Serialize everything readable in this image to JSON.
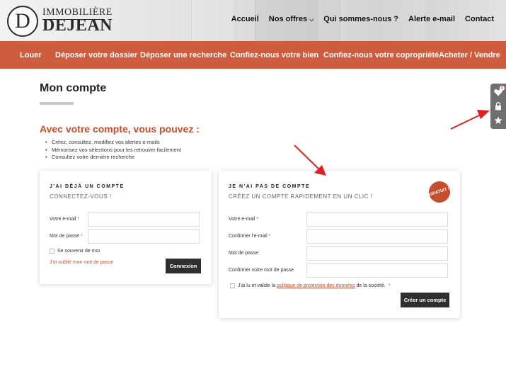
{
  "brand": {
    "logo_letter": "D",
    "line1": "IMMOBILIÈRE",
    "line2": "DEJEAN"
  },
  "top_nav": [
    {
      "label": "Accueil"
    },
    {
      "label": "Nos offres"
    },
    {
      "label": "Qui sommes-nous ?"
    },
    {
      "label": "Alerte e-mail"
    },
    {
      "label": "Contact"
    }
  ],
  "main_nav": [
    {
      "label": "Louer"
    },
    {
      "label": "Déposer votre dossier"
    },
    {
      "label": "Déposer une recherche"
    },
    {
      "label": "Confiez-nous votre bien"
    },
    {
      "label": "Confiez-nous votre copropriété"
    },
    {
      "label": "Acheter / Vendre"
    }
  ],
  "page": {
    "title": "Mon compte",
    "subtitle": "Avec votre compte, vous pouvez :",
    "benefits": [
      "Créez, consultez, modifiez vos alertes e-mails",
      "Mémorisez vos sélections pour les retrouver facilement",
      "Consultez votre dernière recherche"
    ]
  },
  "login": {
    "heading": "J'AI DÉJÀ UN COMPTE",
    "subheading": "CONNECTEZ-VOUS !",
    "email_label": "Votre e-mail",
    "password_label": "Mot de passe",
    "required_mark": "*",
    "remember_label": "Se souvenir de moi",
    "forgot_label": "J'ai oublié mon mot de passe",
    "submit_label": "Connexion"
  },
  "register": {
    "heading": "JE N'AI PAS DE COMPTE",
    "subheading": "CRÉEZ UN COMPTE RAPIDEMENT EN UN CLIC !",
    "badge": "GRATUIT !",
    "email_label": "Votre e-mail",
    "confirm_email_label": "Confirmer l'e-mail",
    "password_label": "Mot de passe",
    "confirm_password_label": "Confirmer votre mot de passe",
    "required_mark": "*",
    "terms_prefix": "J'ai lu et valide la",
    "terms_link": "politique de protection des données",
    "terms_suffix": "de la société.",
    "submit_label": "Créer un compte"
  },
  "side_panel": {
    "favorites_count": "0",
    "icons": [
      "heart-icon",
      "lock-icon",
      "star-icon"
    ]
  },
  "colors": {
    "accent": "#cd5d3e",
    "accent_text": "#c44f2f",
    "button": "#2f2f2f",
    "arrow": "#e02020"
  }
}
